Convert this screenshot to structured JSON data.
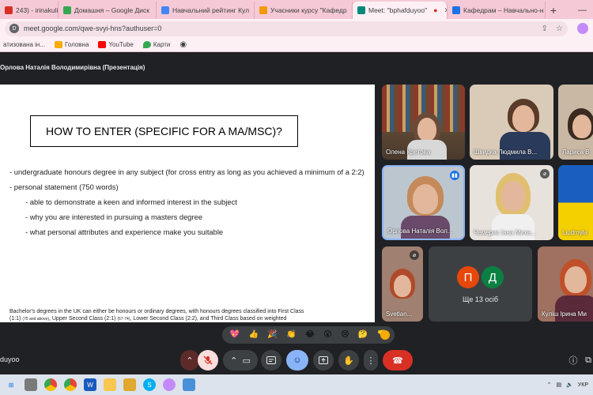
{
  "tabs": [
    {
      "label": "243) - irinakulish",
      "favicon_color": "#d93025",
      "active": false
    },
    {
      "label": "Домашня – Google Диск",
      "favicon_color": "#34a853",
      "active": false
    },
    {
      "label": "Навчальний рейтинг Кул",
      "favicon_color": "#4285f4",
      "active": false
    },
    {
      "label": "Учасники курсу \"Кафедр",
      "favicon_color": "#f29900",
      "active": false
    },
    {
      "label": "Meet: \"bphafduyoo\"",
      "favicon_color": "#00897b",
      "active": true
    },
    {
      "label": "Кафедрам – Навчально-н",
      "favicon_color": "#1a73e8",
      "active": false
    }
  ],
  "address": {
    "url": "meet.google.com/qwe-svyi-hns?authuser=0",
    "site_icon": "D"
  },
  "bookmarks": [
    {
      "label": "атизована ін...",
      "color": "#9aa0a6"
    },
    {
      "label": "Головна",
      "color": "#f9ab00"
    },
    {
      "label": "YouTube",
      "color": "#ff0000"
    },
    {
      "label": "Карти",
      "color": "#34a853"
    }
  ],
  "presenter_label": "Орлова Наталія Володимирівна (Презентація)",
  "slide": {
    "title": "HOW TO ENTER (SPECIFIC FOR A MA/MSC)?",
    "bullet1": "- undergraduate honours degree in any subject (for cross entry as long as you achieved a minimum of a 2:2)",
    "bullet2": "- personal statement (750 words)",
    "sub_bullets": [
      "- able to demonstrate a keen and informed interest in the subject",
      "- why you are interested in pursuing a masters degree",
      "- what personal attributes and experience make you suitable"
    ],
    "footnote_a": "Bachelor's degrees in the UK can either be honours or ordinary degrees, with honours degrees classified into First Class (1:1) ",
    "footnote_small_1": "(75 and above)",
    "footnote_b": ", Upper Second Class (2:1) ",
    "footnote_small_2": "(67-74)",
    "footnote_c": ", Lower Second Class (2:2), and Third Class based on weighted averages of marks."
  },
  "participants": {
    "p1": "Олена Кретова",
    "p2": "Швидка Людмила В...",
    "p3": "Лариса В",
    "p4": "Орлова Наталія Вол...",
    "p5": "Чемерис Інна Миха...",
    "p6": "Liudmyla",
    "p7": "Svetlan...",
    "p9": "Куліш Ірина Ми"
  },
  "more_tile": {
    "label": "Ще 13 осіб",
    "initial1": "П",
    "initial2": "Д",
    "color1": "#e8470b",
    "color2": "#0b8043"
  },
  "reactions": [
    "💖",
    "👍",
    "🎉",
    "👏",
    "😂",
    "😮",
    "😢",
    "🤔",
    "👎"
  ],
  "meeting_code": "duyoo",
  "controls": {
    "end_color": "#d93025",
    "active_blue": "#8ab4f8"
  },
  "tray": {
    "lang": "УКР"
  }
}
